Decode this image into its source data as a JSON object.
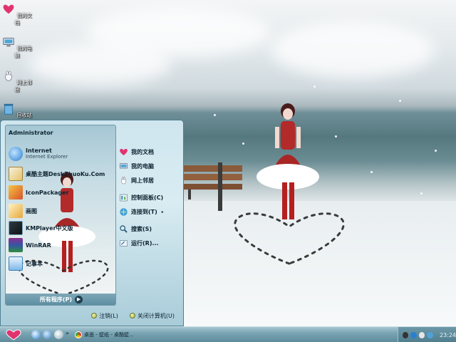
{
  "desktop": {
    "icons": [
      {
        "label": "我的文档",
        "icon": "documents-heart-icon"
      },
      {
        "label": "我的电脑",
        "icon": "computer-icon"
      },
      {
        "label": "网上邻居",
        "icon": "network-icon"
      },
      {
        "label": "回收站",
        "icon": "recycle-bin-icon"
      }
    ]
  },
  "start_menu": {
    "user": "Administrator",
    "pinned": [
      {
        "title": "Internet",
        "subtitle": "Internet Explorer",
        "icon": "internet-explorer-icon"
      },
      {
        "title": "桌酷主题DeskZhuoKu.Com",
        "subtitle": "",
        "icon": "theme-icon"
      },
      {
        "title": "IconPackager",
        "subtitle": "",
        "icon": "iconpackager-icon"
      },
      {
        "title": "画图",
        "subtitle": "",
        "icon": "paint-icon"
      },
      {
        "title": "KMPlayer中文版",
        "subtitle": "",
        "icon": "kmplayer-icon"
      },
      {
        "title": "WinRAR",
        "subtitle": "",
        "icon": "winrar-icon"
      },
      {
        "title": "记事本",
        "subtitle": "",
        "icon": "notepad-icon"
      }
    ],
    "all_programs": "所有程序(P)",
    "right_items": [
      {
        "label": "我的文档",
        "icon": "documents-heart-icon"
      },
      {
        "label": "我的电脑",
        "icon": "computer-icon"
      },
      {
        "label": "网上邻居",
        "icon": "network-icon"
      },
      {
        "label": "控制面板(C)",
        "icon": "control-panel-icon"
      },
      {
        "label": "连接到(T)",
        "icon": "connect-icon",
        "submenu_arrow": "▸"
      },
      {
        "label": "搜索(S)",
        "icon": "search-icon"
      },
      {
        "label": "运行(R)...",
        "icon": "run-icon"
      }
    ],
    "logoff": "注销(L)",
    "shutdown": "关闭计算机(U)"
  },
  "taskbar": {
    "task_button": "桌面 - 壁纸 - 桌酷壁...",
    "clock": "23:24"
  },
  "colors": {
    "taskbar": "#79a4b3",
    "menu_bg": "#cfe6ef",
    "accent_pink": "#e0346f"
  }
}
